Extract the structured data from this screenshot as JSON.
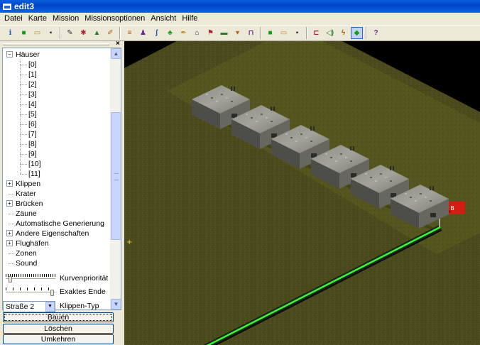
{
  "window": {
    "title": "edit3"
  },
  "menu": [
    "Datei",
    "Karte",
    "Mission",
    "Missionsoptionen",
    "Ansicht",
    "Hilfe"
  ],
  "toolbar": {
    "groups": [
      [
        "info-icon",
        "green-square-icon",
        "open-folder-icon",
        "save-disk-icon"
      ],
      [
        "paint-brush-icon",
        "palette-icon",
        "terrain-icon",
        "edit-icon"
      ],
      [
        "road-icon",
        "unit-icon",
        "signal-icon",
        "tree-icon",
        "paint-icon",
        "building-icon",
        "flag-icon",
        "wall-icon",
        "vehicle-icon",
        "bridge-icon"
      ],
      [
        "green-square-2-icon",
        "open-folder-2-icon",
        "save-disk-2-icon"
      ],
      [
        "tank-icon",
        "sound-icon",
        "zone-icon",
        "select-diamond-icon"
      ],
      [
        "help-icon"
      ]
    ],
    "labels": {
      "info-icon": "ℹ",
      "green-square-icon": "■",
      "open-folder-icon": "▭",
      "save-disk-icon": "▪",
      "paint-brush-icon": "✎",
      "palette-icon": "✱",
      "terrain-icon": "▲",
      "edit-icon": "✐",
      "road-icon": "≡",
      "unit-icon": "♟",
      "signal-icon": "ʃ",
      "tree-icon": "♣",
      "paint-icon": "✒",
      "building-icon": "⌂",
      "flag-icon": "⚑",
      "wall-icon": "▬",
      "vehicle-icon": "▾",
      "bridge-icon": "⊓",
      "green-square-2-icon": "■",
      "open-folder-2-icon": "▭",
      "save-disk-2-icon": "▪",
      "tank-icon": "⊏",
      "sound-icon": "◁)",
      "zone-icon": "ϟ",
      "select-diamond-icon": "◆",
      "help-icon": "?"
    }
  },
  "tree": {
    "root": "Häuser",
    "children": [
      "[0]",
      "[1]",
      "[2]",
      "[3]",
      "[4]",
      "[5]",
      "[6]",
      "[7]",
      "[8]",
      "[9]",
      "[10]",
      "[11]"
    ],
    "siblings": [
      {
        "label": "Klippen",
        "expandable": true
      },
      {
        "label": "Krater",
        "expandable": false
      },
      {
        "label": "Brücken",
        "expandable": true
      },
      {
        "label": "Zäune",
        "expandable": false
      },
      {
        "label": "Automatische Generierung",
        "expandable": false,
        "selected": true
      },
      {
        "label": "Andere Eigenschaften",
        "expandable": true
      },
      {
        "label": "Flughäfen",
        "expandable": true
      },
      {
        "label": "Zonen",
        "expandable": false
      },
      {
        "label": "Sound",
        "expandable": false
      }
    ]
  },
  "controls": {
    "curve_priority_label": "Kurvenpriorität",
    "exact_end_label": "Exaktes Ende",
    "cliff_type_label": "Klippen-Typ",
    "road_type_value": "Straße 2",
    "build_button": "Bauen",
    "delete_button": "Löschen",
    "reverse_button": "Umkehren"
  },
  "map": {
    "marker_label": "B",
    "colors": {
      "void": "#000000",
      "grass_dark": "#4b4a1c",
      "grass_light": "#56561f",
      "road_glow": "#3df23d",
      "flag": "#d41d12"
    },
    "bunker_count": 6
  }
}
